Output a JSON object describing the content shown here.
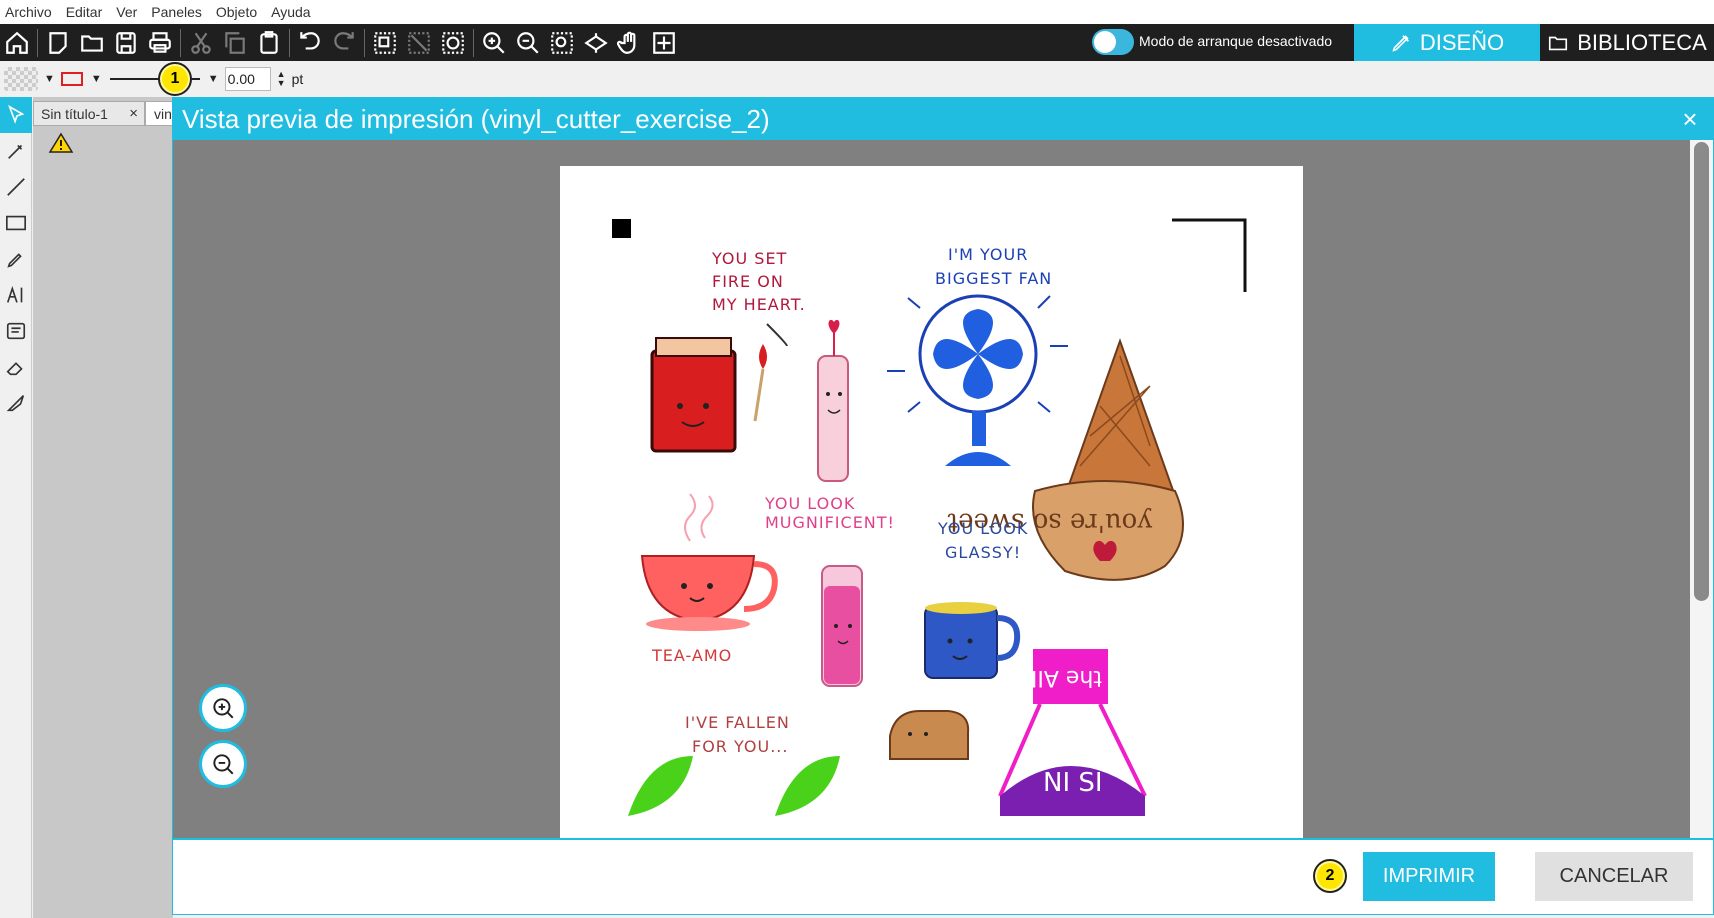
{
  "menu": [
    "Archivo",
    "Editar",
    "Ver",
    "Paneles",
    "Objeto",
    "Ayuda"
  ],
  "toolbar": {
    "mode_label": "Modo de arranque desactivado",
    "tab_design": "DISEÑO",
    "tab_library": "BIBLIOTECA"
  },
  "props": {
    "stroke_width": "0.00",
    "unit": "pt"
  },
  "docs": {
    "tab1": "Sin título-1",
    "tab1_close": "×",
    "tab2": "vin"
  },
  "dialog": {
    "title": "Vista previa de impresión (vinyl_cutter_exercise_2)",
    "close": "×",
    "print_label": "IMPRIMIR",
    "cancel_label": "CANCELAR"
  },
  "stickers": {
    "fire": [
      "YOU SET",
      "FIRE ON",
      "MY HEART."
    ],
    "fan": [
      "I'M YOUR",
      "BIGGEST FAN"
    ],
    "magnificent": [
      "YOU LOOK",
      "MUGNIFICENT!"
    ],
    "glassy": [
      "YOU LOOK",
      "GLASSY!"
    ],
    "tea": "TEA-AMO",
    "fallen": [
      "I'VE FALLEN",
      "FOR YOU..."
    ],
    "sweet": "you're so sweet",
    "air": "the AIR",
    "nisi": "NI SI"
  },
  "markers": [
    "1",
    "2"
  ],
  "colors": {
    "accent": "#20bde0",
    "toolbar": "#1f1f1f",
    "preview_bg": "#808080"
  }
}
